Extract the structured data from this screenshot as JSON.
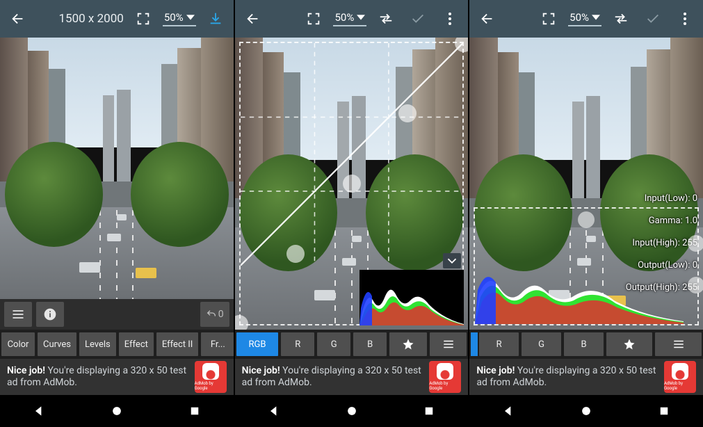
{
  "panel1": {
    "dimensions": "1500 x 2000",
    "zoom": "50%",
    "undo_count": "0",
    "tabs": [
      "Color",
      "Curves",
      "Levels",
      "Effect",
      "Effect II",
      "Fr..."
    ]
  },
  "panel2": {
    "zoom": "50%",
    "tabs": [
      "RGB",
      "R",
      "G",
      "B"
    ],
    "active_tab": "RGB"
  },
  "panel3": {
    "zoom": "50%",
    "tabs": [
      "R",
      "G",
      "B"
    ],
    "levels": {
      "input_low_label": "Input(Low):",
      "input_low": "0",
      "gamma_label": "Gamma:",
      "gamma": "1.0",
      "input_high_label": "Input(High):",
      "input_high": "255",
      "output_low_label": "Output(Low):",
      "output_low": "0",
      "output_high_label": "Output(High):",
      "output_high": "255"
    }
  },
  "ad": {
    "headline": "Nice job!",
    "body": "You're displaying a 320 x 50 test ad from AdMob.",
    "brand": "AdMob by Google"
  }
}
